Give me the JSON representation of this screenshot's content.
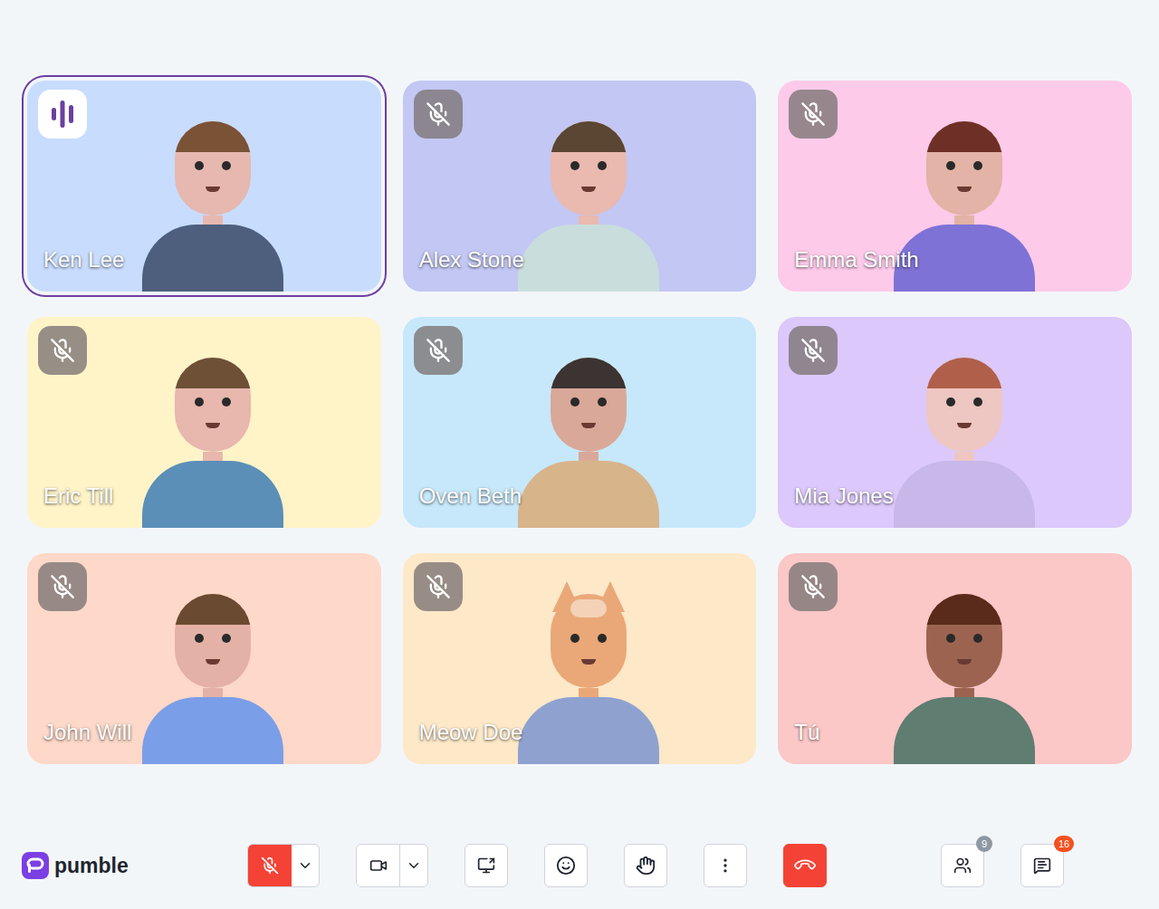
{
  "participants": [
    {
      "name": "Ken Lee",
      "muted": false,
      "speaking": true,
      "color": "#c8dcfe",
      "kind": "person",
      "avatar": {
        "skin": "#e6b8b0",
        "hair": "#7a5236",
        "shirt": "#4e5f7e"
      }
    },
    {
      "name": "Alex Stone",
      "muted": true,
      "speaking": false,
      "color": "#c3c7f3",
      "kind": "person",
      "avatar": {
        "skin": "#eab9b0",
        "hair": "#5a4632",
        "shirt": "#c9dedc"
      }
    },
    {
      "name": "Emma Smith",
      "muted": true,
      "speaking": false,
      "color": "#fdcaea",
      "kind": "person",
      "avatar": {
        "skin": "#e2b3a6",
        "hair": "#6e2f26",
        "shirt": "#7f72d6"
      }
    },
    {
      "name": "Eric Till",
      "muted": true,
      "speaking": false,
      "color": "#fff4c8",
      "kind": "person",
      "avatar": {
        "skin": "#e8b7ae",
        "hair": "#6d5036",
        "shirt": "#5b8fb8"
      }
    },
    {
      "name": "Oven Beth",
      "muted": true,
      "speaking": false,
      "color": "#c7e8fb",
      "kind": "person",
      "avatar": {
        "skin": "#d9a898",
        "hair": "#3b3433",
        "shirt": "#d8b48a"
      }
    },
    {
      "name": "Mia Jones",
      "muted": true,
      "speaking": false,
      "color": "#dcc8fb",
      "kind": "person",
      "avatar": {
        "skin": "#eec6c2",
        "hair": "#b0604a",
        "shirt": "#c8b8ea"
      }
    },
    {
      "name": "John Will",
      "muted": true,
      "speaking": false,
      "color": "#fed8c8",
      "kind": "person",
      "avatar": {
        "skin": "#e4b1a6",
        "hair": "#6a4a30",
        "shirt": "#7a9ee8"
      }
    },
    {
      "name": "Meow Doe",
      "muted": true,
      "speaking": false,
      "color": "#fde8c8",
      "kind": "cat",
      "avatar": {
        "skin": "#eaa878",
        "hair": "#f3d2b8",
        "shirt": "#8fa2cf"
      }
    },
    {
      "name": "Tú",
      "muted": true,
      "speaking": false,
      "color": "#fbc7c7",
      "kind": "person",
      "avatar": {
        "skin": "#9c6450",
        "hair": "#5a2a1a",
        "shirt": "#5f7d70"
      }
    }
  ],
  "toolbar": {
    "logo": "pumble",
    "mic_muted": true,
    "camera_on": true
  },
  "participants_button": {
    "count": "9"
  },
  "chat_button": {
    "count": "16"
  }
}
